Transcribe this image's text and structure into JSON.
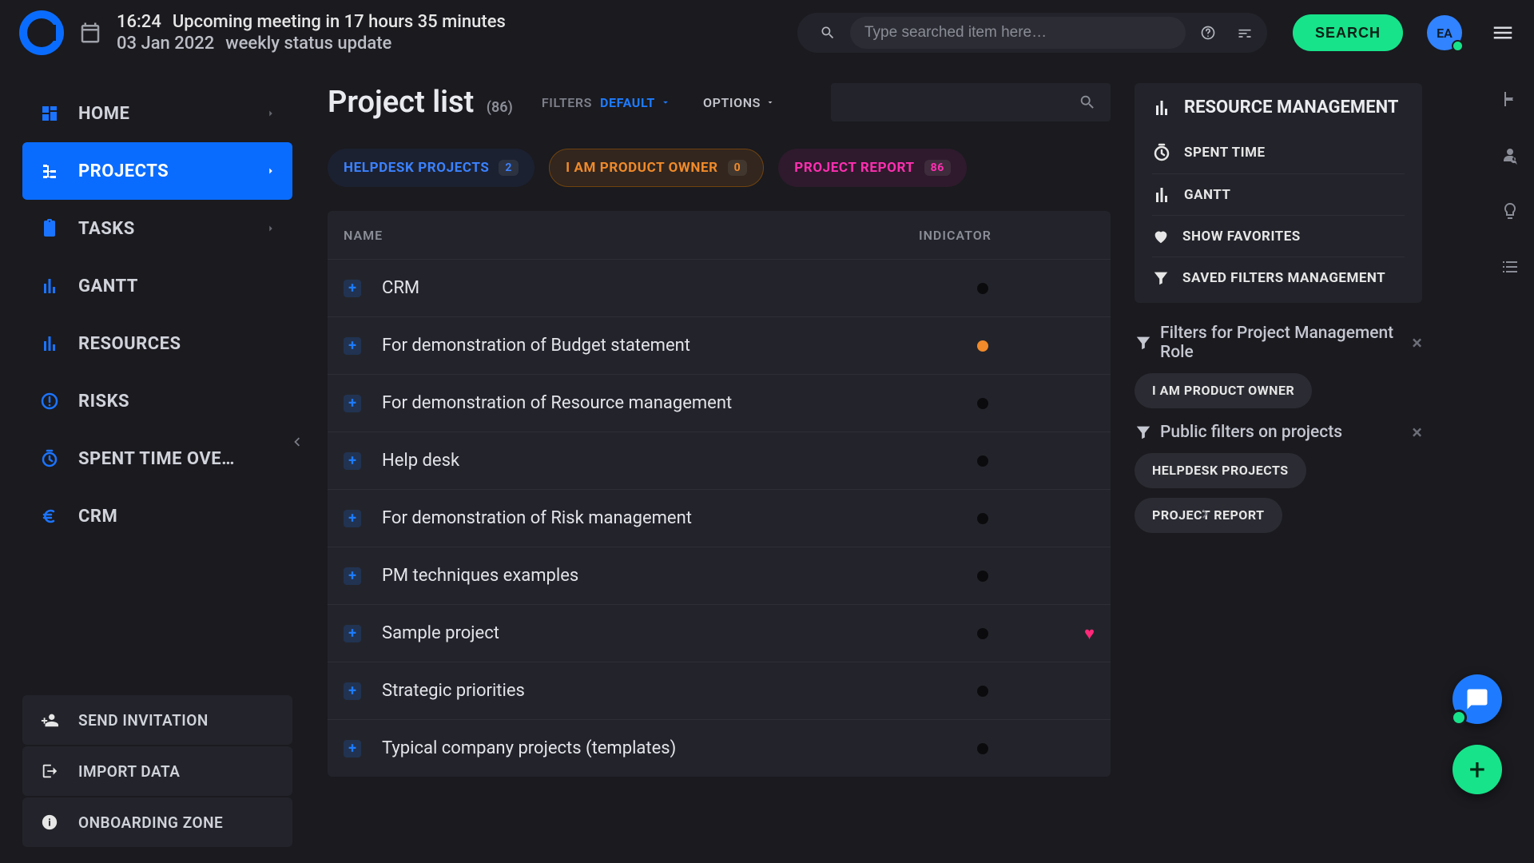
{
  "header": {
    "time": "16:24",
    "upcoming_label": "Upcoming meeting in 17 hours 35 minutes",
    "date": "03 Jan 2022",
    "upcoming_name": "weekly status update",
    "search_placeholder": "Type searched item here…",
    "search_button": "SEARCH",
    "avatar_initials": "EA"
  },
  "sidebar": {
    "items": [
      {
        "label": "HOME",
        "icon": "dashboard",
        "chev": true,
        "active": false
      },
      {
        "label": "PROJECTS",
        "icon": "tree",
        "chev": true,
        "active": true
      },
      {
        "label": "TASKS",
        "icon": "clipboard",
        "chev": true,
        "active": false
      },
      {
        "label": "GANTT",
        "icon": "bars",
        "chev": false,
        "active": false
      },
      {
        "label": "RESOURCES",
        "icon": "bars",
        "chev": false,
        "active": false
      },
      {
        "label": "RISKS",
        "icon": "alert",
        "chev": false,
        "active": false
      },
      {
        "label": "SPENT TIME OVE…",
        "icon": "clock",
        "chev": false,
        "active": false
      },
      {
        "label": "CRM",
        "icon": "euro",
        "chev": false,
        "active": false
      }
    ],
    "actions": [
      {
        "label": "SEND INVITATION",
        "icon": "person_add"
      },
      {
        "label": "IMPORT DATA",
        "icon": "export"
      },
      {
        "label": "ONBOARDING ZONE",
        "icon": "info"
      }
    ]
  },
  "page": {
    "title": "Project list",
    "count": "(86)",
    "filters_label": "FILTERS",
    "filters_value": "DEFAULT",
    "options_label": "OPTIONS"
  },
  "pills": [
    {
      "label": "HELPDESK PROJECTS",
      "count": "2",
      "tone": "blue"
    },
    {
      "label": "I AM PRODUCT OWNER",
      "count": "0",
      "tone": "orange"
    },
    {
      "label": "PROJECT REPORT",
      "count": "86",
      "tone": "pink"
    }
  ],
  "table": {
    "col_name": "NAME",
    "col_indicator": "INDICATOR",
    "rows": [
      {
        "name": "CRM",
        "dot": "black",
        "fav": false
      },
      {
        "name": "For demonstration of Budget statement",
        "dot": "orange",
        "fav": false
      },
      {
        "name": "For demonstration of Resource management",
        "dot": "black",
        "fav": false
      },
      {
        "name": "Help desk",
        "dot": "black",
        "fav": false
      },
      {
        "name": "For demonstration of Risk management",
        "dot": "black",
        "fav": false
      },
      {
        "name": "PM techniques examples",
        "dot": "black",
        "fav": false
      },
      {
        "name": "Sample project",
        "dot": "black",
        "fav": true
      },
      {
        "name": "Strategic priorities",
        "dot": "black",
        "fav": false
      },
      {
        "name": "Typical company projects (templates)",
        "dot": "black",
        "fav": false
      }
    ]
  },
  "rightPanel": {
    "title": "RESOURCE MANAGEMENT",
    "items": [
      {
        "label": "SPENT TIME",
        "icon": "clock"
      },
      {
        "label": "GANTT",
        "icon": "bars"
      },
      {
        "label": "SHOW FAVORITES",
        "icon": "heart"
      },
      {
        "label": "SAVED FILTERS MANAGEMENT",
        "icon": "funnel"
      }
    ],
    "filterGroups": [
      {
        "title": "Filters for Project Management Role",
        "chips": [
          "I AM PRODUCT OWNER"
        ]
      },
      {
        "title": "Public filters on projects",
        "chips": [
          "HELPDESK PROJECTS",
          "PROJECT REPORT"
        ]
      }
    ]
  }
}
